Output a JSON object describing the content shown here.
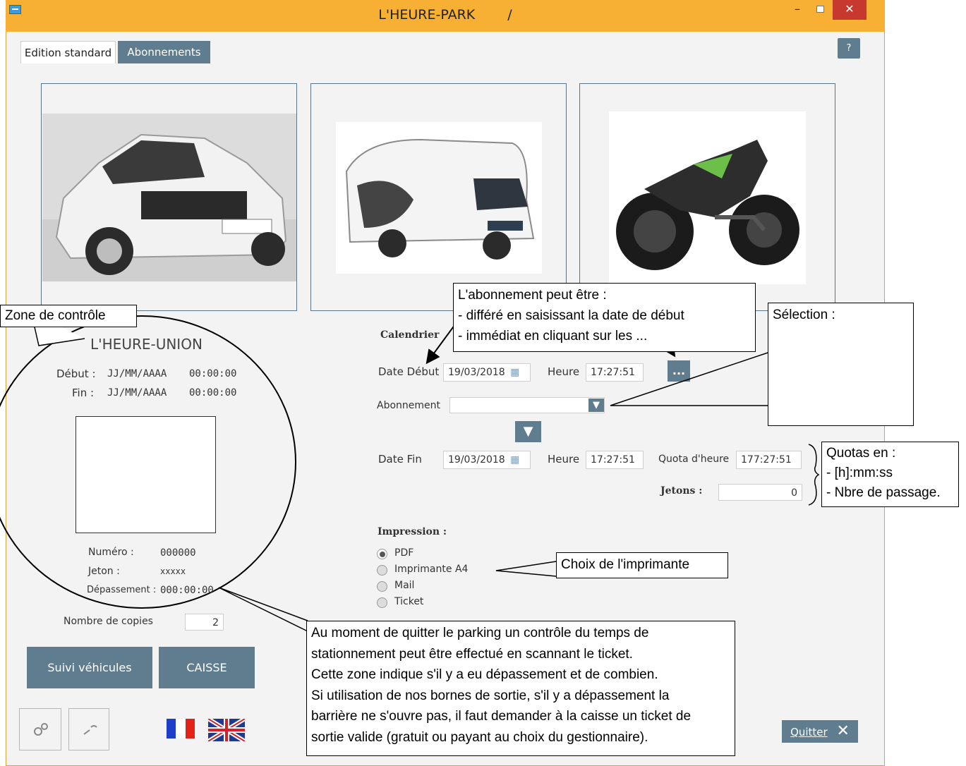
{
  "window": {
    "title": "L'HEURE-PARK",
    "title_suffix": "/",
    "help": "?"
  },
  "tabs": [
    {
      "label": "Edition standard"
    },
    {
      "label": "Abonnements"
    }
  ],
  "vehicles": [
    {
      "name": "car-photo"
    },
    {
      "name": "camper-van-photo"
    },
    {
      "name": "motorcycle-photo"
    }
  ],
  "control": {
    "callout": "Zone de contrôle",
    "company": "L'HEURE-UNION",
    "debut_label": "Début :",
    "debut_date": "JJ/MM/AAAA",
    "debut_time": "00:00:00",
    "fin_label": "Fin :",
    "fin_date": "JJ/MM/AAAA",
    "fin_time": "00:00:00",
    "numero_label": "Numéro :",
    "numero_value": "000000",
    "jeton_label": "Jeton :",
    "jeton_value": "xxxxx",
    "depassement_label": "Dépassement :",
    "depassement_value": "000:00:00"
  },
  "copies": {
    "label": "Nombre de copies",
    "value": "2"
  },
  "buttons": {
    "suivi": "Suivi véhicules",
    "caisse": "CAISSE",
    "quitter": "Quitter",
    "ellipsis": "..."
  },
  "calendar": {
    "heading": "Calendrier",
    "date_debut_label": "Date Début",
    "date_debut_value": "19/03/2018",
    "heure_label": "Heure",
    "heure_debut_value": "17:27:51",
    "abonnement_label": "Abonnement",
    "abonnement_value": "",
    "date_fin_label": "Date Fin",
    "date_fin_value": "19/03/2018",
    "heure_fin_value": "17:27:51",
    "quota_label": "Quota d'heure",
    "quota_value": "177:27:51",
    "jetons_label": "Jetons :",
    "jetons_value": "0"
  },
  "impression": {
    "heading": "Impression :",
    "options": [
      {
        "label": "PDF",
        "selected": true
      },
      {
        "label": "Imprimante A4",
        "selected": false
      },
      {
        "label": "Mail",
        "selected": false
      },
      {
        "label": "Ticket",
        "selected": false
      }
    ]
  },
  "callouts": {
    "abonnement_lines": [
      "L'abonnement peut être :",
      "- différé en saisissant la date de début",
      "- immédiat en cliquant sur les ..."
    ],
    "selection": "Sélection :",
    "quotas_lines": [
      "Quotas en :",
      "- [h]:mm:ss",
      "- Nbre de passage."
    ],
    "printer": "Choix de l'imprimante",
    "control_lines": [
      "Au moment de quitter le parking un contrôle du temps de",
      "stationnement peut être effectué en scannant le ticket.",
      "Cette zone indique s'il y a eu dépassement et de combien.",
      "Si utilisation de nos bornes de sortie, s'il y a dépassement la",
      "barrière ne s'ouvre pas, il faut demander à la caisse un ticket de",
      "sortie valide (gratuit ou payant au choix du gestionnaire)."
    ]
  },
  "colors": {
    "titlebar": "#f7b033",
    "accent": "#607d8f",
    "close": "#c7382e"
  }
}
